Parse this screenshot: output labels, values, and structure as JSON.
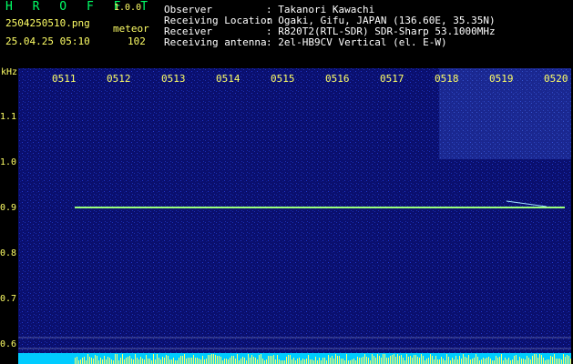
{
  "header": {
    "brand": "H R O F F T",
    "version": "1.0.0",
    "filename": "2504250510.png",
    "mode": "meteor",
    "datetime": "25.04.25 05:10",
    "count": "102",
    "info": [
      {
        "label": "Observer",
        "value": ": Takanori Kawachi"
      },
      {
        "label": "Receiving Location",
        "value": ": Ogaki, Gifu, JAPAN (136.60E, 35.35N)"
      },
      {
        "label": "Receiver",
        "value": ": R820T2(RTL-SDR) SDR-Sharp 53.1000MHz"
      },
      {
        "label": "Receiving antenna",
        "value": ": 2el-HB9CV Vertical (el. E-W)"
      }
    ]
  },
  "axis": {
    "unit": "kHz",
    "y_ticks": [
      "1.1",
      "1.0",
      "0.9",
      "0.8",
      "0.7",
      "0.6"
    ],
    "x_ticks": [
      "0511",
      "0512",
      "0513",
      "0514",
      "0515",
      "0516",
      "0517",
      "0518",
      "0519",
      "0520"
    ]
  },
  "colors": {
    "background": "#000000",
    "spectrum": "#0a0f6e",
    "trace": "#ffff66",
    "text_green": "#00ff66",
    "text_white": "#ffffff"
  }
}
